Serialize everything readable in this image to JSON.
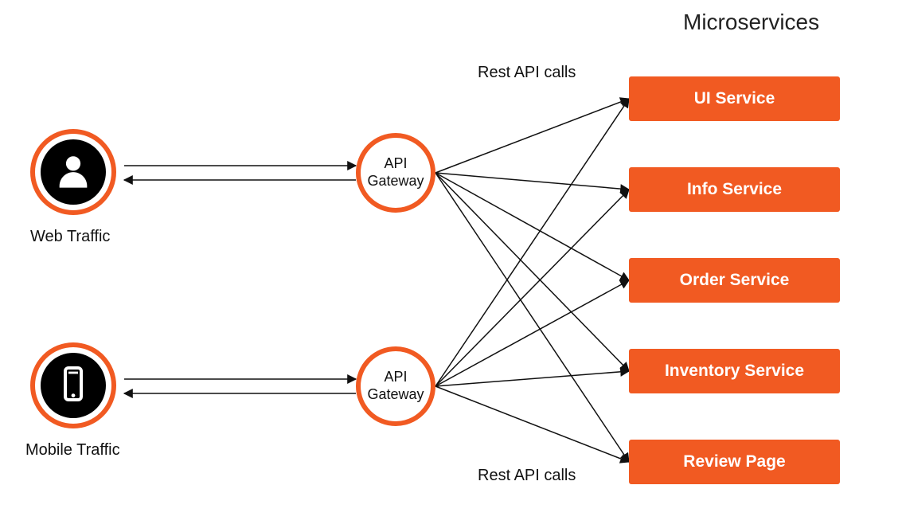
{
  "title": "Microservices",
  "clients": {
    "web": {
      "label": "Web Traffic"
    },
    "mobile": {
      "label": "Mobile Traffic"
    }
  },
  "gateways": {
    "top": {
      "label": "API\nGateway"
    },
    "bottom": {
      "label": "API\nGateway"
    }
  },
  "edge_labels": {
    "top": "Rest API calls",
    "bottom": "Rest API calls"
  },
  "services": [
    {
      "label": "UI Service"
    },
    {
      "label": "Info Service"
    },
    {
      "label": "Order Service"
    },
    {
      "label": "Inventory Service"
    },
    {
      "label": "Review Page"
    }
  ],
  "colors": {
    "accent": "#f15a22",
    "node_fill": "#000000",
    "text": "#111111",
    "service_text": "#ffffff"
  }
}
